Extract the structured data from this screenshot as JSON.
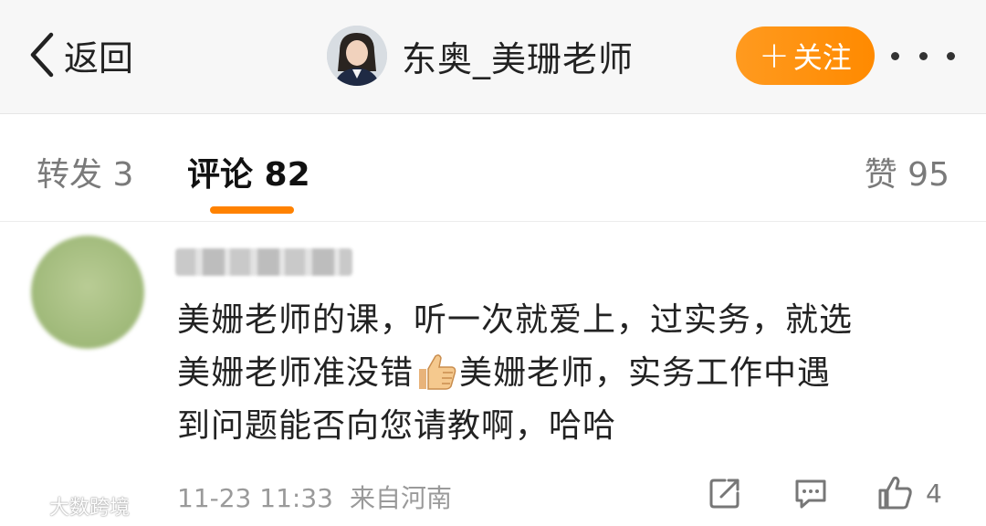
{
  "header": {
    "back_label": "返回",
    "username": "东奥_美珊老师",
    "follow_plus": "+",
    "follow_label": "关注"
  },
  "tabs": {
    "repost": "转发 3",
    "comment": "评论 82",
    "like": "赞 95"
  },
  "comment": {
    "lines": [
      "美姗老师的课，听一次就爱上，过实务，就选",
      "美姗老师准没错",
      "美姗老师，实务工作中遇",
      "到问题能否向您请教啊，哈哈"
    ],
    "time": "11-23 11:33",
    "source": "来自河南",
    "like_count": "4"
  },
  "watermark": {
    "text": "大数跨境"
  },
  "colors": {
    "accent": "#ff8200",
    "follow_button": "#ff9a1f"
  },
  "icons": [
    "back-chevron-icon",
    "more-dots-icon",
    "thumbs-up-emoji-icon",
    "share-icon",
    "reply-icon",
    "like-icon"
  ]
}
